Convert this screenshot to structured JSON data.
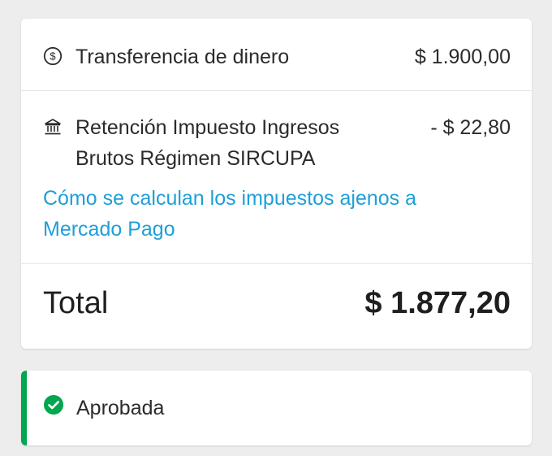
{
  "transfer": {
    "label": "Transferencia de dinero",
    "amount": "$ 1.900,00",
    "icon": "dollar-circle-icon"
  },
  "retention": {
    "label_line1": "Retención Impuesto Ingresos",
    "label_line2": "Brutos Régimen SIRCUPA",
    "amount": "- $ 22,80",
    "icon": "bank-icon"
  },
  "tax_link": {
    "line1": "Cómo se calculan los impuestos ajenos a",
    "line2": "Mercado Pago"
  },
  "total": {
    "label": "Total",
    "amount": "$ 1.877,20"
  },
  "status": {
    "label": "Aprobada",
    "icon": "check-circle-icon",
    "color": "#00a650"
  },
  "colors": {
    "link": "#1e9fd8",
    "background": "#ededed",
    "card": "#ffffff"
  }
}
